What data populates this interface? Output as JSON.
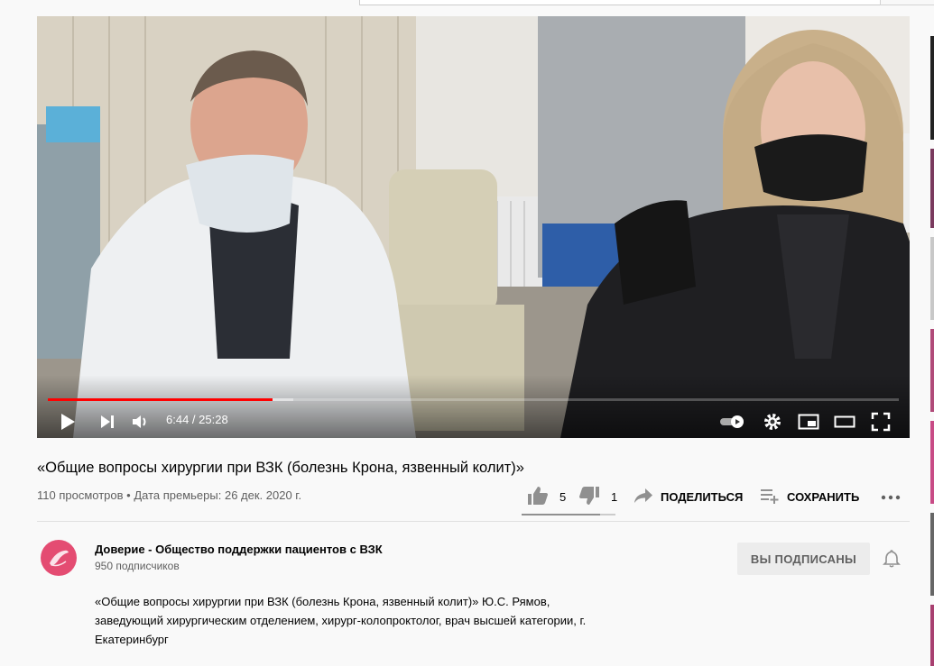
{
  "video": {
    "time_current": "6:44",
    "time_separator": " / ",
    "time_total": "25:28",
    "progress_played_fraction": 0.2643,
    "progress_buffered_fraction": 0.288
  },
  "title": "«Общие вопросы хирургии при ВЗК (болезнь Крона, язвенный колит)»",
  "meta": {
    "views": "110 просмотров",
    "separator": " • ",
    "premiere": "Дата премьеры: 26 дек. 2020 г."
  },
  "actions": {
    "likes": "5",
    "dislikes": "1",
    "share_label": "ПОДЕЛИТЬСЯ",
    "save_label": "СОХРАНИТЬ",
    "like_ratio_fraction": 0.8333
  },
  "channel": {
    "name": "Доверие - Общество поддержки пациентов с ВЗК",
    "subscribers": "950 подписчиков",
    "subscribed_label": "ВЫ ПОДПИСАНЫ"
  },
  "description": {
    "lines": [
      "«Общие вопросы хирургии при ВЗК (болезнь Крона, язвенный колит)» Ю.С. Рямов,",
      "заведующий хирургическим отделением, хирург-колопроктолог, врач высшей категории, г.",
      "Екатеринбург"
    ]
  },
  "icons": {
    "play": "play-icon",
    "next": "next-icon",
    "volume": "volume-icon",
    "autoplay": "autoplay-toggle-icon",
    "settings": "gear-icon",
    "miniplayer": "miniplayer-icon",
    "theater": "theater-mode-icon",
    "fullscreen": "fullscreen-icon",
    "like": "thumbs-up-icon",
    "dislike": "thumbs-down-icon",
    "share": "share-arrow-icon",
    "save": "playlist-add-icon",
    "more": "more-horizontal-icon",
    "bell": "bell-icon"
  },
  "colors": {
    "progress": "#ff0000",
    "avatar": "#e44c72"
  }
}
